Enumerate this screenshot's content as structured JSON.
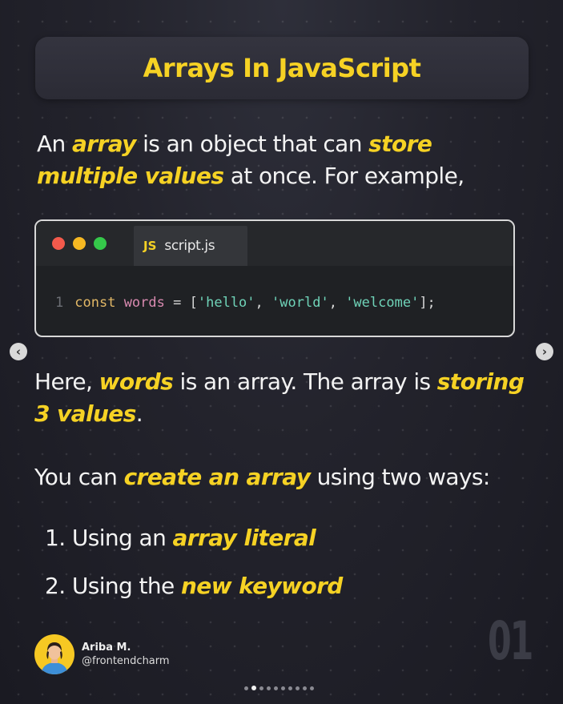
{
  "title": "Arrays In JavaScript",
  "intro": {
    "t1": "An ",
    "h1": "array",
    "t2": " is an object that can ",
    "h2": "store multiple values",
    "t3": " at once. For example,"
  },
  "code": {
    "filetype": "JS",
    "filename": "script.js",
    "line_number": "1",
    "keyword": "const",
    "variable": "words",
    "equals": "=",
    "open": "[",
    "items": [
      "'hello'",
      "'world'",
      "'welcome'"
    ],
    "comma": ",",
    "close": "];"
  },
  "explain": {
    "t1": "Here, ",
    "h1": "words",
    "t2": " is an array. The array is ",
    "h2": "storing 3 values",
    "t3": "."
  },
  "ways": {
    "t1": "You can ",
    "h1": "create an array",
    "t2": " using two ways:"
  },
  "list": [
    {
      "num": "1.",
      "text": "Using an ",
      "hl": "array literal"
    },
    {
      "num": "2.",
      "text": "Using the ",
      "hl": "new keyword"
    }
  ],
  "author": {
    "name": "Ariba M.",
    "handle": "@frontendcharm"
  },
  "page_number": "01",
  "nav": {
    "prev_icon": "chevron-left-icon",
    "next_icon": "chevron-right-icon"
  },
  "pagination": {
    "total": 10,
    "active": 1
  },
  "colors": {
    "accent": "#f6d224",
    "background": "#23232c",
    "code_bg": "#1f2124"
  }
}
